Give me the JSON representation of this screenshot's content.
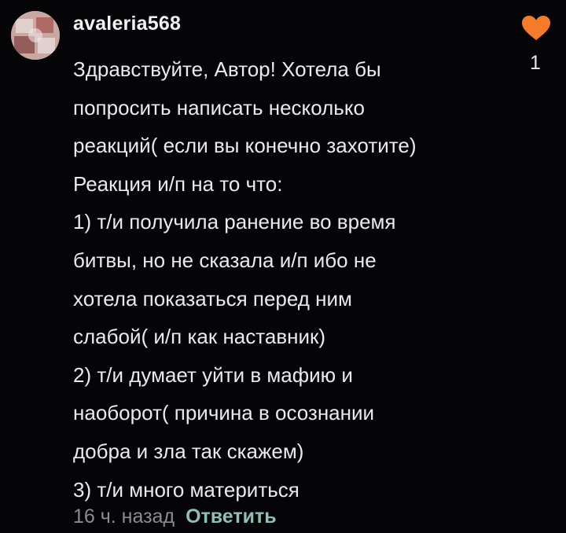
{
  "comment": {
    "username": "avaleria568",
    "lines": [
      "Здравствуйте, Автор! Хотела бы",
      "попросить написать несколько",
      "реакций( если вы конечно захотите)",
      "Реакция и/п на то что:",
      "1) т/и получила ранение во время",
      "битвы, но не сказала и/п ибо не",
      "хотела показаться перед ним",
      "слабой( и/п как наставник)",
      "2) т/и думает уйти в мафию и",
      "наоборот( причина в осознании",
      "добра и зла так скажем)",
      "3) т/и много материться"
    ],
    "timestamp": "16 ч. назад",
    "reply_label": "Ответить",
    "like_count": "1",
    "like_icon": "heart-icon",
    "colors": {
      "background": "#050507",
      "heart": "#f47b2a",
      "reply": "#8fbfb5",
      "timestamp": "#8c8c8c"
    }
  }
}
